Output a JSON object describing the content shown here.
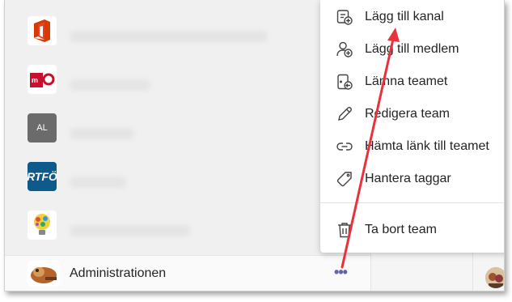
{
  "teams": [
    {
      "logo_icon": "office-icon"
    },
    {
      "logo_icon": "mro-logo-icon"
    },
    {
      "logo_text": "AL"
    },
    {
      "logo_text": "RTFÖ"
    },
    {
      "logo_icon": "lightbulb-icon"
    }
  ],
  "selected_team": {
    "name": "Administrationen",
    "more_label": "•••"
  },
  "menu": {
    "items": [
      {
        "label": "Lägg till kanal",
        "icon": "add-channel-icon"
      },
      {
        "label": "Lägg till medlem",
        "icon": "add-member-icon"
      },
      {
        "label": "Lämna teamet",
        "icon": "leave-team-icon"
      },
      {
        "label": "Redigera team",
        "icon": "edit-pencil-icon"
      },
      {
        "label": "Hämta länk till teamet",
        "icon": "link-icon"
      },
      {
        "label": "Hantera taggar",
        "icon": "tag-icon"
      },
      {
        "label": "Ta bort team",
        "icon": "trash-icon"
      }
    ]
  },
  "colors": {
    "accent": "#6264a7",
    "arrow": "#e8323c",
    "office_red": "#d83b01",
    "mro_red": "#c8102e",
    "rtf_blue": "#0e5a8a"
  }
}
